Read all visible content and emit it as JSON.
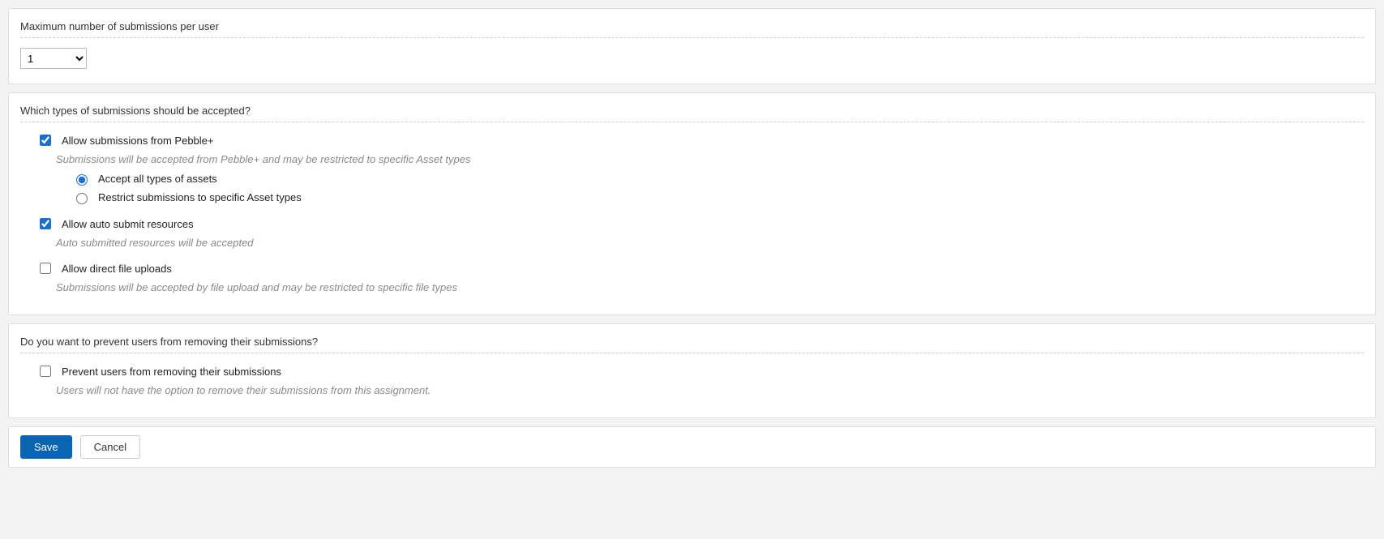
{
  "section1": {
    "title": "Maximum number of submissions per user",
    "selected_value": "1"
  },
  "section2": {
    "title": "Which types of submissions should be accepted?",
    "allow_pebble": {
      "label": "Allow submissions from Pebble+",
      "desc": "Submissions will be accepted from Pebble+ and may be restricted to specific Asset types",
      "checked": true,
      "radio_accept_all_label": "Accept all types of assets",
      "radio_restrict_label": "Restrict submissions to specific Asset types",
      "radio_selected": "accept_all"
    },
    "allow_auto": {
      "label": "Allow auto submit resources",
      "desc": "Auto submitted resources will be accepted",
      "checked": true
    },
    "allow_direct": {
      "label": "Allow direct file uploads",
      "desc": "Submissions will be accepted by file upload and may be restricted to specific file types",
      "checked": false
    }
  },
  "section3": {
    "title": "Do you want to prevent users from removing their submissions?",
    "prevent_remove": {
      "label": "Prevent users from removing their submissions",
      "desc": "Users will not have the option to remove their submissions from this assignment.",
      "checked": false
    }
  },
  "actions": {
    "save": "Save",
    "cancel": "Cancel"
  }
}
